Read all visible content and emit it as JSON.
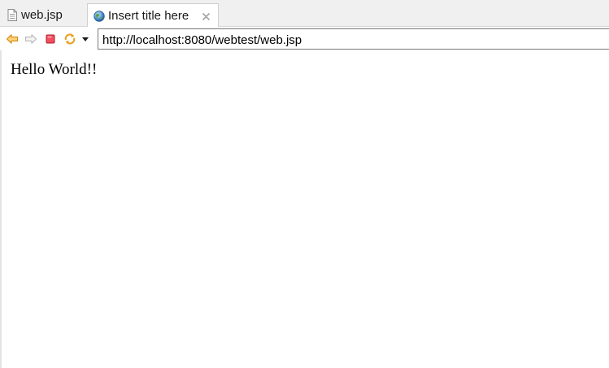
{
  "tabs": [
    {
      "label": "web.jsp",
      "icon": "file-icon",
      "active": false
    },
    {
      "label": "Insert title here",
      "icon": "globe-icon",
      "active": true
    }
  ],
  "toolbar": {
    "url": "http://localhost:8080/webtest/web.jsp",
    "icons": [
      "back-arrow-icon",
      "forward-arrow-icon",
      "stop-icon",
      "refresh-icon",
      "dropdown-arrow-icon"
    ]
  },
  "page": {
    "body_text": "Hello World!!"
  },
  "colors": {
    "tab_bar_bg": "#f0f0f0",
    "back_arrow": "#f0a830",
    "stop": "#e0303c",
    "refresh": "#e8a020"
  }
}
